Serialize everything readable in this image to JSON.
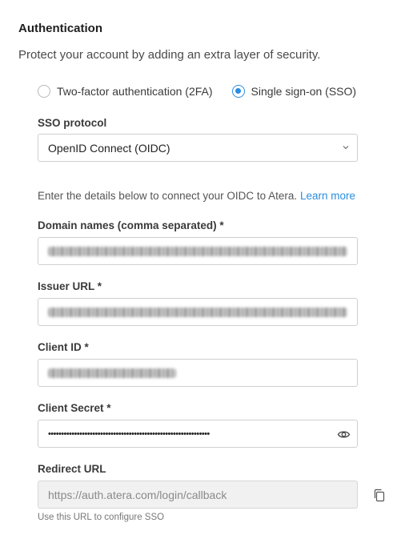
{
  "section": {
    "title": "Authentication",
    "subtitle": "Protect your account by adding an extra layer of security."
  },
  "methods": {
    "options": [
      {
        "label": "Two-factor authentication (2FA)",
        "selected": false
      },
      {
        "label": "Single sign-on (SSO)",
        "selected": true
      }
    ]
  },
  "protocol": {
    "label": "SSO protocol",
    "value": "OpenID Connect (OIDC)"
  },
  "info": {
    "text": "Enter the details below to connect your OIDC to Atera. ",
    "link": "Learn more"
  },
  "domains": {
    "label": "Domain names (comma separated) *"
  },
  "issuer": {
    "label": "Issuer URL *"
  },
  "client_id": {
    "label": "Client ID *"
  },
  "client_secret": {
    "label": "Client Secret *",
    "value": "••••••••••••••••••••••••••••••••••••••••••••••••••••••••••••••"
  },
  "redirect": {
    "label": "Redirect URL",
    "value": "https://auth.atera.com/login/callback",
    "help": "Use this URL to configure SSO"
  },
  "colors": {
    "accent": "#2a8de0"
  }
}
